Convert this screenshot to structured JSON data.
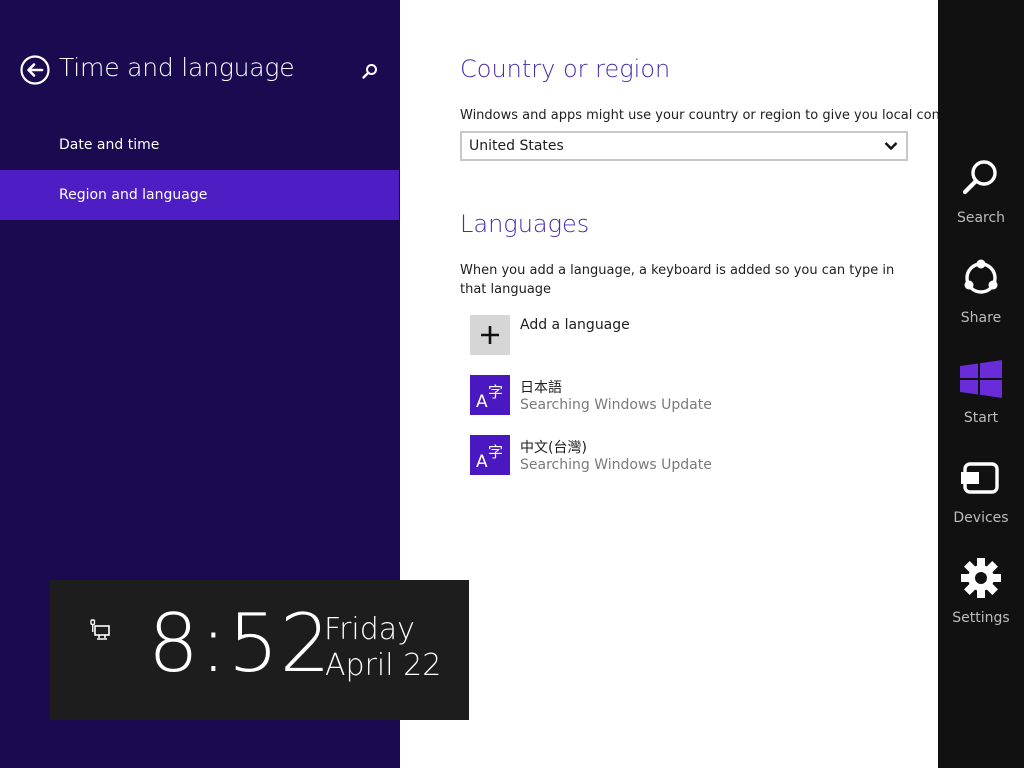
{
  "sidebar": {
    "title": "Time and language",
    "items": [
      {
        "label": "Date and time"
      },
      {
        "label": "Region and language"
      }
    ]
  },
  "country": {
    "heading": "Country or region",
    "description": "Windows and apps might use your country or region to give you local content",
    "selected": "United States"
  },
  "languages": {
    "heading": "Languages",
    "description": "When you add a language, a keyboard is added so you can type in that language",
    "add_label": "Add a language",
    "items": [
      {
        "name": "日本語",
        "status": "Searching Windows Update"
      },
      {
        "name": "中文(台灣)",
        "status": "Searching Windows Update"
      }
    ]
  },
  "clock": {
    "time": "8:52",
    "day": "Friday",
    "date": "April 22"
  },
  "charms": [
    {
      "label": "Search",
      "icon": "search-icon"
    },
    {
      "label": "Share",
      "icon": "share-icon"
    },
    {
      "label": "Start",
      "icon": "windows-logo-icon"
    },
    {
      "label": "Devices",
      "icon": "devices-icon"
    },
    {
      "label": "Settings",
      "icon": "gear-icon"
    }
  ],
  "colors": {
    "sidebar_bg": "#1b0a4f",
    "accent": "#4e1ec4",
    "heading": "#4a2bad",
    "charms_bg": "#111111"
  }
}
